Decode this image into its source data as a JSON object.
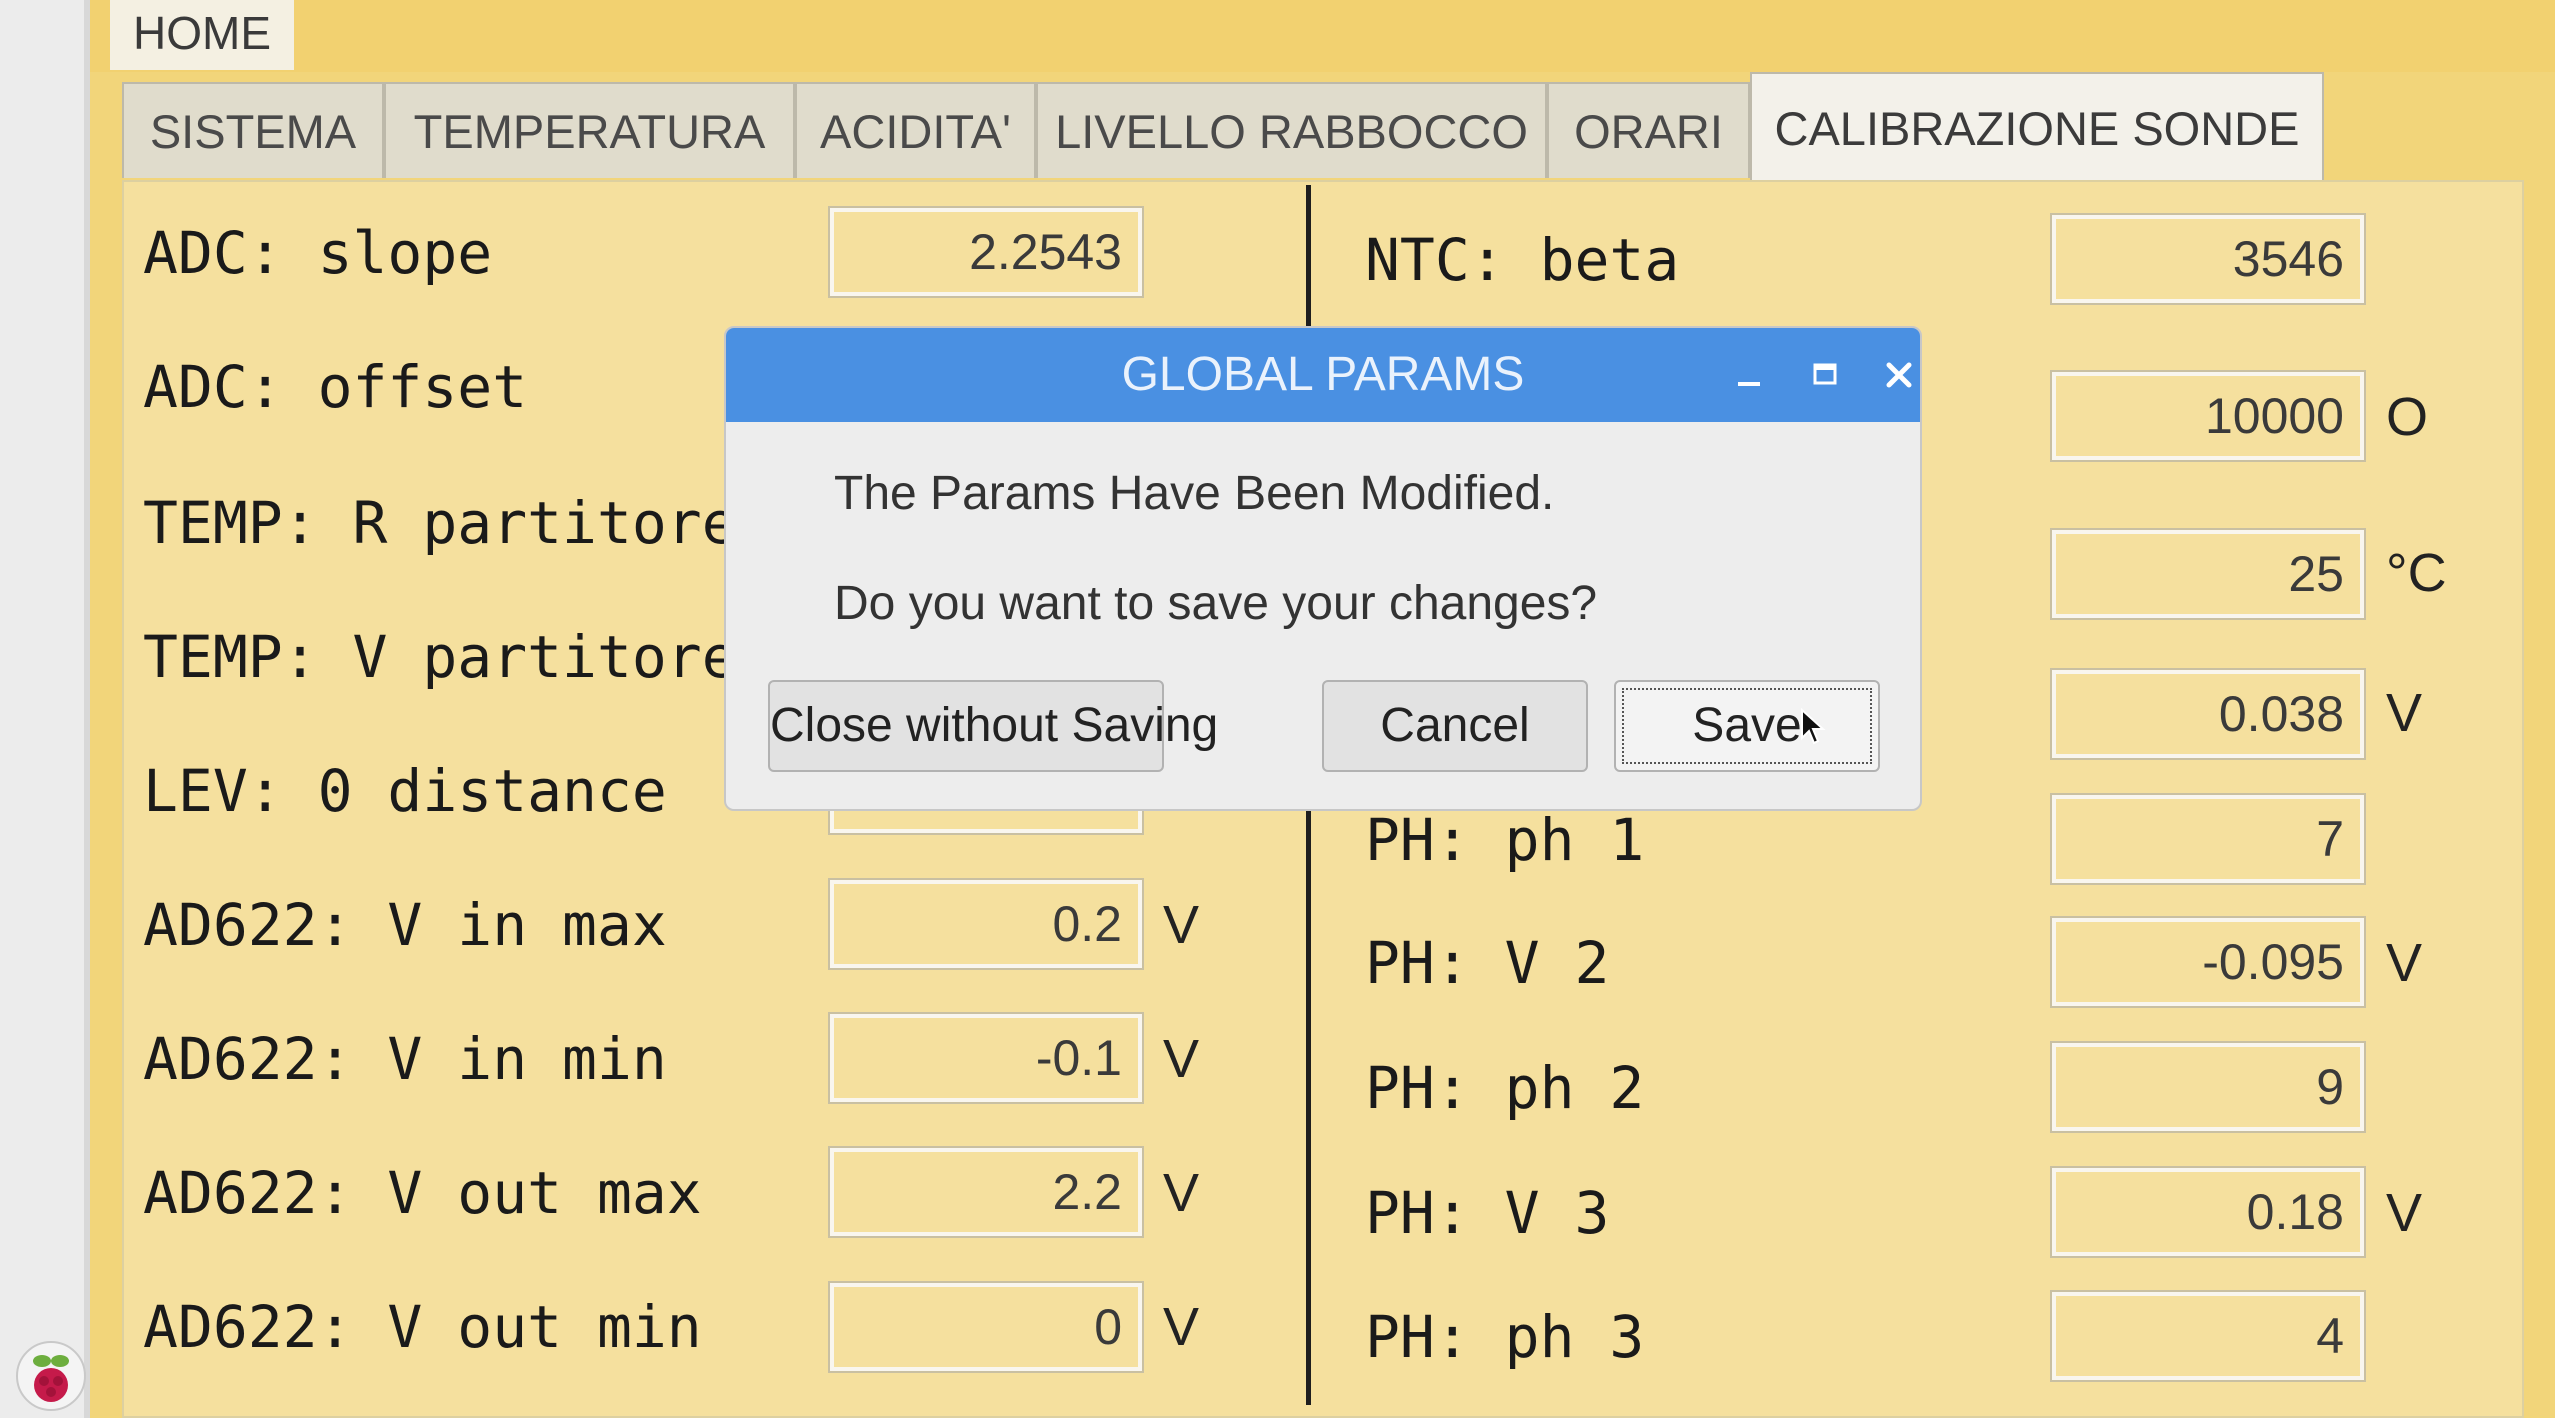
{
  "home_tab": {
    "label": "HOME"
  },
  "tabs": [
    {
      "label": "SISTEMA"
    },
    {
      "label": "TEMPERATURA"
    },
    {
      "label": "ACIDITA'"
    },
    {
      "label": "LIVELLO RABBOCCO"
    },
    {
      "label": "ORARI"
    },
    {
      "label": "CALIBRAZIONE SONDE",
      "active": true
    }
  ],
  "left_params": [
    {
      "label": "ADC: slope",
      "value": "2.2543",
      "unit": ""
    },
    {
      "label": "ADC: offset",
      "value": "",
      "unit": ""
    },
    {
      "label": "TEMP: R partitore",
      "value": "",
      "unit": ""
    },
    {
      "label": "TEMP: V partitore",
      "value": "",
      "unit": ""
    },
    {
      "label": "LEV: 0 distance",
      "value": "",
      "unit": ""
    },
    {
      "label": "AD622: V in max",
      "value": "0.2",
      "unit": "V"
    },
    {
      "label": "AD622: V in min",
      "value": "-0.1",
      "unit": "V"
    },
    {
      "label": "AD622: V out max",
      "value": "2.2",
      "unit": "V"
    },
    {
      "label": "AD622: V out min",
      "value": "0",
      "unit": "V"
    }
  ],
  "right_params": [
    {
      "label": "NTC: beta",
      "value": "3546",
      "unit": ""
    },
    {
      "label": "",
      "value": "10000",
      "unit": "O"
    },
    {
      "label": "",
      "value": "25",
      "unit": "°C"
    },
    {
      "label": "",
      "value": "0.038",
      "unit": "V"
    },
    {
      "label": "PH: ph 1",
      "value": "7",
      "unit": ""
    },
    {
      "label": "PH: V 2",
      "value": "-0.095",
      "unit": "V"
    },
    {
      "label": "PH: ph 2",
      "value": "9",
      "unit": ""
    },
    {
      "label": "PH: V 3",
      "value": "0.18",
      "unit": "V"
    },
    {
      "label": "PH: ph 3",
      "value": "4",
      "unit": ""
    }
  ],
  "dialog": {
    "title": "GLOBAL PARAMS",
    "message": "The Params Have Been Modified.",
    "question": "Do you want to save your changes?",
    "buttons": {
      "close_without_saving": "Close without Saving",
      "cancel": "Cancel",
      "save": "Save"
    },
    "title_bar_color": "#4a90e2"
  },
  "colors": {
    "panel_bg": "#f5e09e",
    "topbar_bg": "#f2d170"
  },
  "icons": {
    "minimize": "minimize-icon",
    "maximize": "maximize-icon",
    "close": "close-icon",
    "raspberry": "raspberry-pi-logo"
  }
}
